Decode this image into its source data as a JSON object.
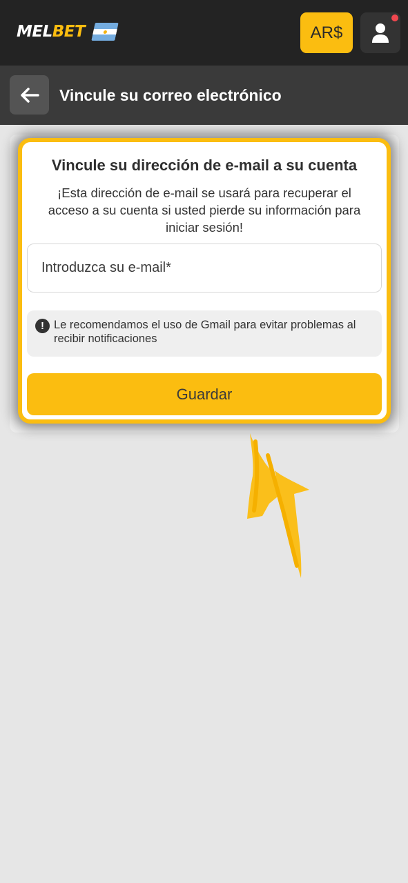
{
  "header": {
    "logo_part1": "MEL",
    "logo_part2": "BET",
    "flag_icon": "argentina-flag-icon",
    "currency_label": "AR$",
    "profile_icon": "user-icon",
    "has_notification": true,
    "accent_color": "#fbbd10"
  },
  "subheader": {
    "back_icon": "arrow-left-icon",
    "title": "Vincule su correo electrónico"
  },
  "card": {
    "title": "Vincule su dirección de e-mail a su cuenta",
    "description": "¡Esta dirección de e-mail se usará para recuperar el acceso a su cuenta si usted pierde su información para iniciar sesión!",
    "email_placeholder": "Introduzca su e-mail*",
    "email_value": "",
    "hint_icon": "exclamation-icon",
    "hint_text": "Le recomendamos el uso de Gmail para evitar problemas al recibir notificaciones",
    "save_label": "Guardar"
  },
  "annotation": {
    "arrow_icon": "hand-drawn-arrow-up-icon",
    "arrow_color": "#fbbd10"
  }
}
